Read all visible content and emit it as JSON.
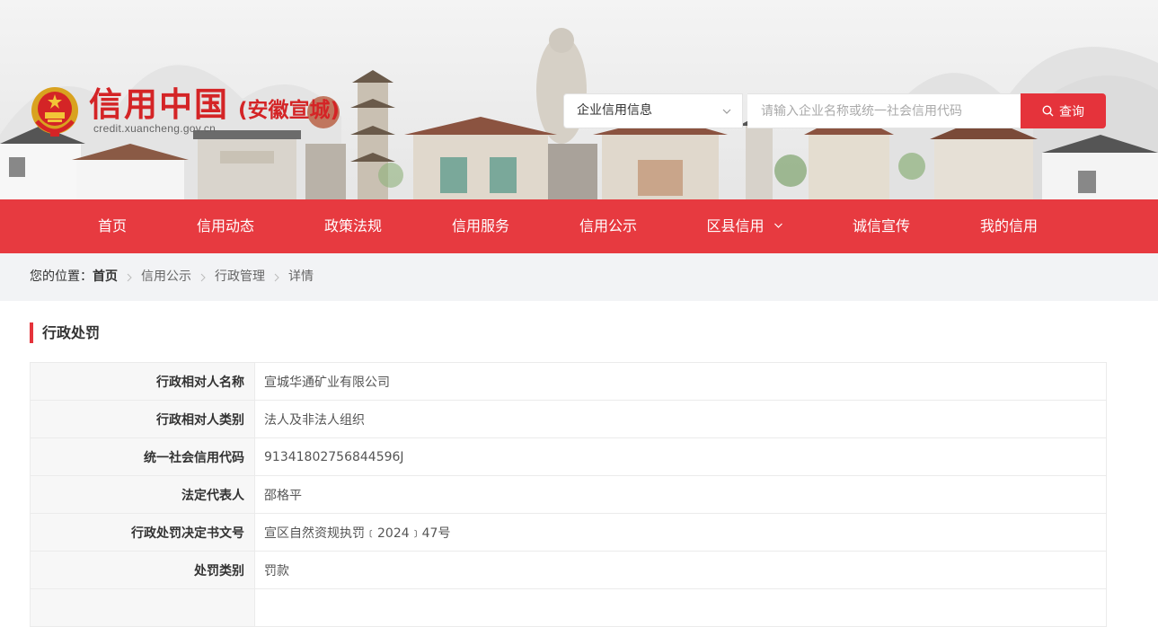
{
  "header": {
    "logo_title": "信用中国",
    "logo_sub": "(安徽宣城)",
    "logo_domain": "credit.xuancheng.gov.cn",
    "search": {
      "category": "企业信用信息",
      "placeholder": "请输入企业名称或统一社会信用代码",
      "button_label": "查询"
    }
  },
  "nav": {
    "items": [
      {
        "label": "首页"
      },
      {
        "label": "信用动态"
      },
      {
        "label": "政策法规"
      },
      {
        "label": "信用服务"
      },
      {
        "label": "信用公示"
      },
      {
        "label": "区县信用"
      },
      {
        "label": "诚信宣传"
      },
      {
        "label": "我的信用"
      }
    ]
  },
  "breadcrumb": {
    "prefix": "您的位置：",
    "items": [
      "首页",
      "信用公示",
      "行政管理",
      "详情"
    ]
  },
  "section": {
    "title": "行政处罚",
    "rows": [
      {
        "key": "行政相对人名称",
        "value": "宣城华通矿业有限公司"
      },
      {
        "key": "行政相对人类别",
        "value": "法人及非法人组织"
      },
      {
        "key": "统一社会信用代码",
        "value": "91341802756844596J"
      },
      {
        "key": "法定代表人",
        "value": "邵格平"
      },
      {
        "key": "行政处罚决定书文号",
        "value": "宣区自然资规执罚﹝2024﹞47号"
      },
      {
        "key": "处罚类别",
        "value": "罚款"
      },
      {
        "key": "",
        "value": ""
      }
    ]
  },
  "colors": {
    "brand_red": "#e73a40",
    "logo_red": "#d42426"
  }
}
